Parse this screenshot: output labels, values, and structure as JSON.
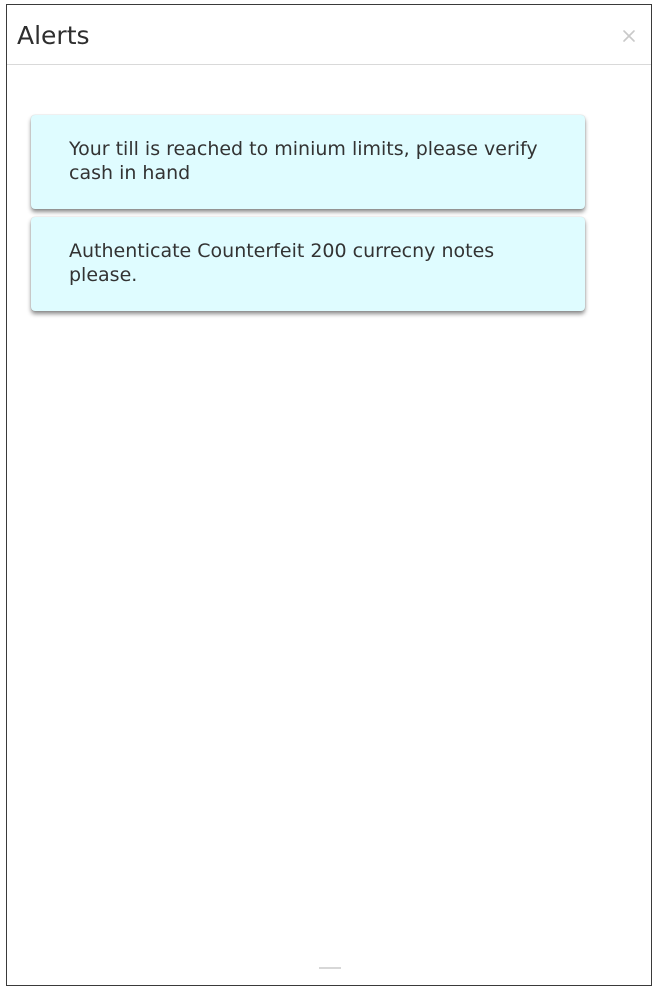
{
  "panel": {
    "title": "Alerts",
    "close_icon": "close-icon"
  },
  "alerts": [
    {
      "message": "Your till is reached to minium limits, please verify cash in hand"
    },
    {
      "message": "Authenticate Counterfeit 200 currecny notes please."
    }
  ],
  "colors": {
    "alert_background": "#dffcff",
    "border": "#3a3a3a",
    "header_divider": "#d9d9d9"
  }
}
